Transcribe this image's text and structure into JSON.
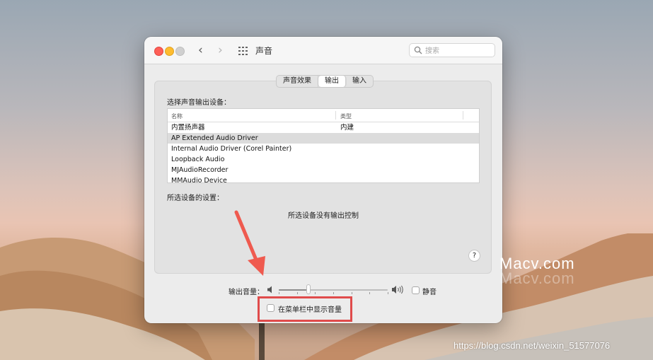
{
  "window": {
    "title": "声音",
    "search_placeholder": "搜索"
  },
  "tabs": [
    "声音效果",
    "输出",
    "输入"
  ],
  "active_tab": "输出",
  "output": {
    "select_label": "选择声音输出设备：",
    "columns": [
      "名称",
      "类型"
    ],
    "devices": [
      {
        "name": "内置扬声器",
        "type": "内建"
      },
      {
        "name": "AP Extended Audio Driver",
        "type": ""
      },
      {
        "name": "Internal Audio Driver (Corel Painter)",
        "type": ""
      },
      {
        "name": "Loopback Audio",
        "type": ""
      },
      {
        "name": "MJAudioRecorder",
        "type": ""
      },
      {
        "name": "MMAudio Device",
        "type": ""
      }
    ],
    "selected_device": "AP Extended Audio Driver",
    "settings_label": "所选设备的设置：",
    "no_control_text": "所选设备没有输出控制",
    "help": "?"
  },
  "volume": {
    "label": "输出音量：",
    "level": 0.27,
    "mute_label": "静音",
    "mute_checked": false
  },
  "menubar_option": {
    "label": "在菜单栏中显示音量",
    "checked": false
  },
  "annotation": {
    "highlight_color": "#e04b4b"
  },
  "watermarks": {
    "macv": "Macv.com",
    "csdn": "https://blog.csdn.net/weixin_51577076"
  },
  "colors": {
    "close": "#fe5f57",
    "minimize": "#febc2e",
    "zoom_disabled": "#d0d0d0",
    "selected_row": "#dcdcdc"
  }
}
